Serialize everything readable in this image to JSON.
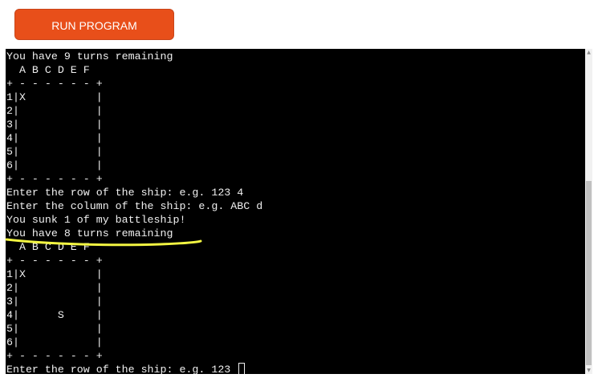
{
  "toolbar": {
    "run_label": "RUN PROGRAM",
    "accent_color": "#e84f1a"
  },
  "terminal": {
    "lines": [
      "You have 9 turns remaining",
      "  A B C D E F",
      "+ - - - - - - +",
      "1|X           |",
      "2|            |",
      "3|            |",
      "4|            |",
      "5|            |",
      "6|            |",
      "+ - - - - - - +",
      "Enter the row of the ship: e.g. 123 4",
      "Enter the column of the ship: e.g. ABC d",
      "You sunk 1 of my battleship!",
      "You have 8 turns remaining",
      "  A B C D E F",
      "+ - - - - - - +",
      "1|X           |",
      "2|            |",
      "3|            |",
      "4|      S     |",
      "5|            |",
      "6|            |",
      "+ - - - - - - +"
    ],
    "prompt": "Enter the row of the ship: e.g. 123 ",
    "background": "#000000",
    "text_color": "#f0f0f0"
  },
  "annotation": {
    "color": "#f2f542",
    "highlighted_line": "You have 8 turns remaining"
  },
  "scrollbar": {
    "up_icon": "▲",
    "down_icon": "▼"
  }
}
